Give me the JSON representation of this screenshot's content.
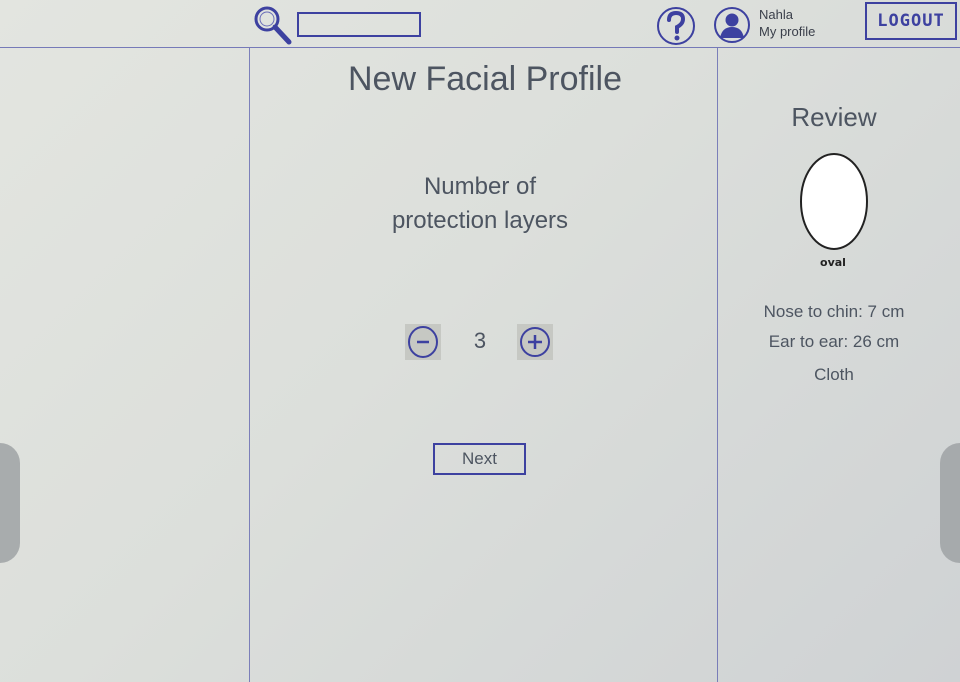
{
  "header": {
    "user_name": "Nahla",
    "profile_link": "My profile",
    "logout_label": "LOGOUT"
  },
  "main": {
    "title": "New Facial Profile",
    "question_line1": "Number of",
    "question_line2": "protection layers",
    "layers_count": "3",
    "next_label": "Next"
  },
  "review": {
    "title": "Review",
    "face_shape": "oval",
    "nose_to_chin": "Nose to chin: 7 cm",
    "ear_to_ear": "Ear to ear: 26 cm",
    "material": "Cloth"
  },
  "colors": {
    "ink": "#3d41a0",
    "text": "#4d5561"
  }
}
